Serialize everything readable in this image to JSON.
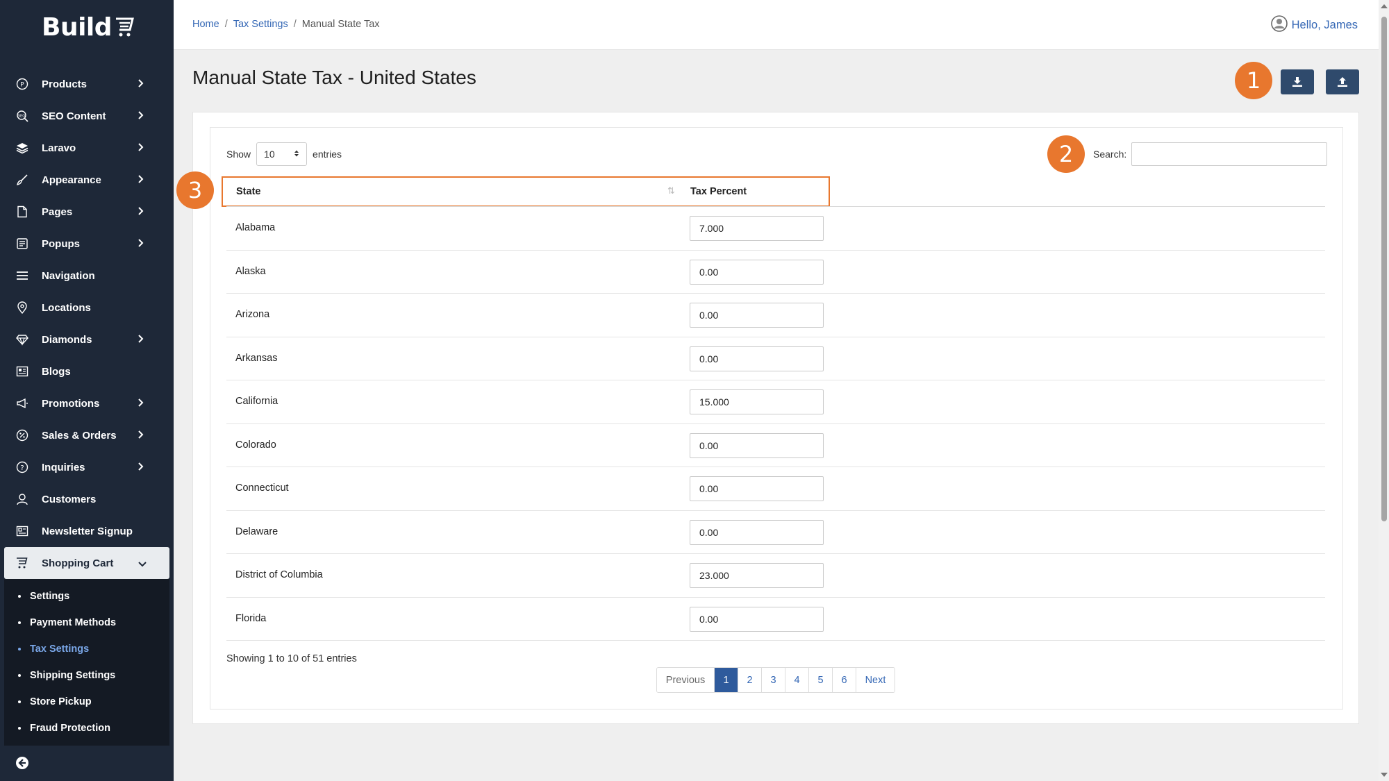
{
  "app": {
    "logo_text": "Build",
    "user_greeting": "Hello, James"
  },
  "breadcrumb": {
    "home": "Home",
    "tax_settings": "Tax Settings",
    "current": "Manual State Tax"
  },
  "sidebar": {
    "items": [
      {
        "label": "Products",
        "icon": "products-icon",
        "has_children": true
      },
      {
        "label": "SEO Content",
        "icon": "seo-icon",
        "has_children": true
      },
      {
        "label": "Laravo",
        "icon": "layers-icon",
        "has_children": true
      },
      {
        "label": "Appearance",
        "icon": "brush-icon",
        "has_children": true
      },
      {
        "label": "Pages",
        "icon": "page-icon",
        "has_children": true
      },
      {
        "label": "Popups",
        "icon": "popup-icon",
        "has_children": true
      },
      {
        "label": "Navigation",
        "icon": "menu-icon",
        "has_children": false
      },
      {
        "label": "Locations",
        "icon": "location-pin-icon",
        "has_children": false
      },
      {
        "label": "Diamonds",
        "icon": "diamond-icon",
        "has_children": true
      },
      {
        "label": "Blogs",
        "icon": "newspaper-icon",
        "has_children": false
      },
      {
        "label": "Promotions",
        "icon": "megaphone-icon",
        "has_children": true
      },
      {
        "label": "Sales & Orders",
        "icon": "percent-badge-icon",
        "has_children": true
      },
      {
        "label": "Inquiries",
        "icon": "question-circle-icon",
        "has_children": true
      },
      {
        "label": "Customers",
        "icon": "user-icon",
        "has_children": false
      },
      {
        "label": "Newsletter Signup",
        "icon": "newsletter-icon",
        "has_children": false
      }
    ],
    "active_item": {
      "label": "Shopping Cart",
      "icon": "cart-icon"
    },
    "submenu": [
      {
        "label": "Settings"
      },
      {
        "label": "Payment Methods"
      },
      {
        "label": "Tax Settings",
        "current": true
      },
      {
        "label": "Shipping Settings"
      },
      {
        "label": "Store Pickup"
      },
      {
        "label": "Fraud Protection"
      }
    ]
  },
  "page": {
    "title": "Manual State Tax - United States",
    "badges": [
      "1",
      "2",
      "3"
    ]
  },
  "table": {
    "show_label": "Show",
    "entries_label": "entries",
    "page_length": "10",
    "search_label": "Search:",
    "search_value": "",
    "columns": [
      "State",
      "Tax Percent"
    ],
    "rows": [
      {
        "state": "Alabama",
        "tax": "7.000"
      },
      {
        "state": "Alaska",
        "tax": "0.00"
      },
      {
        "state": "Arizona",
        "tax": "0.00"
      },
      {
        "state": "Arkansas",
        "tax": "0.00"
      },
      {
        "state": "California",
        "tax": "15.000"
      },
      {
        "state": "Colorado",
        "tax": "0.00"
      },
      {
        "state": "Connecticut",
        "tax": "0.00"
      },
      {
        "state": "Delaware",
        "tax": "0.00"
      },
      {
        "state": "District of Columbia",
        "tax": "23.000"
      },
      {
        "state": "Florida",
        "tax": "0.00"
      }
    ],
    "info": "Showing 1 to 10 of 51 entries",
    "pagination": {
      "previous": "Previous",
      "next": "Next",
      "pages": [
        "1",
        "2",
        "3",
        "4",
        "5",
        "6"
      ],
      "current": "1"
    }
  },
  "colors": {
    "sidebar_bg": "#1e2838",
    "accent_orange": "#e8772e",
    "button_navy": "#2f4a6c",
    "link_blue": "#3467b5",
    "active_page": "#2e5a9c"
  }
}
